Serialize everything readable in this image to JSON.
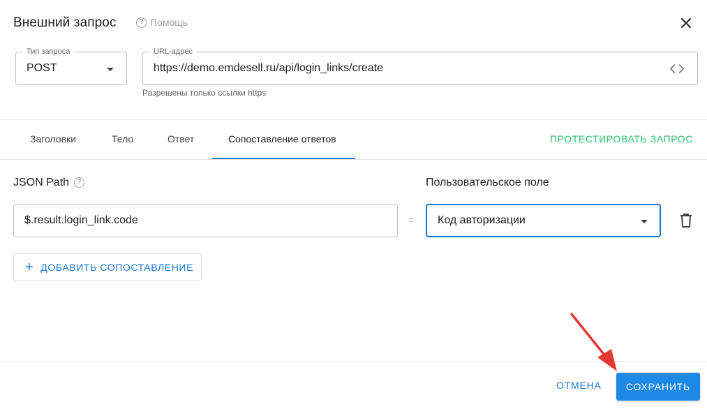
{
  "dialog": {
    "title": "Внешний запрос",
    "help_label": "Помощь"
  },
  "request": {
    "method_label": "Тип запроса",
    "method_value": "POST",
    "url_label": "URL-адрес",
    "url_value": "https://demo.emdesell.ru/api/login_links/create",
    "url_hint": "Разрешены только ссылки https"
  },
  "tabs": [
    {
      "label": "Заголовки",
      "active": false
    },
    {
      "label": "Тело",
      "active": false
    },
    {
      "label": "Ответ",
      "active": false
    },
    {
      "label": "Сопоставление ответов",
      "active": true
    }
  ],
  "test_button": "ПРОТЕСТИРОВАТЬ ЗАПРОС",
  "mapping": {
    "json_path_label": "JSON Path",
    "custom_field_label": "Пользовательское поле",
    "rows": [
      {
        "json_path": "$.result.login_link.code",
        "equals": "=",
        "custom_field": "Код авторизации"
      }
    ],
    "add_button": "ДОБАВИТЬ СОПОСТАВЛЕНИЕ"
  },
  "footer": {
    "cancel": "ОТМЕНА",
    "save": "СОХРАНИТЬ"
  },
  "colors": {
    "primary": "#1e88e5",
    "success": "#27c46b",
    "annotation_arrow": "#e53935"
  }
}
